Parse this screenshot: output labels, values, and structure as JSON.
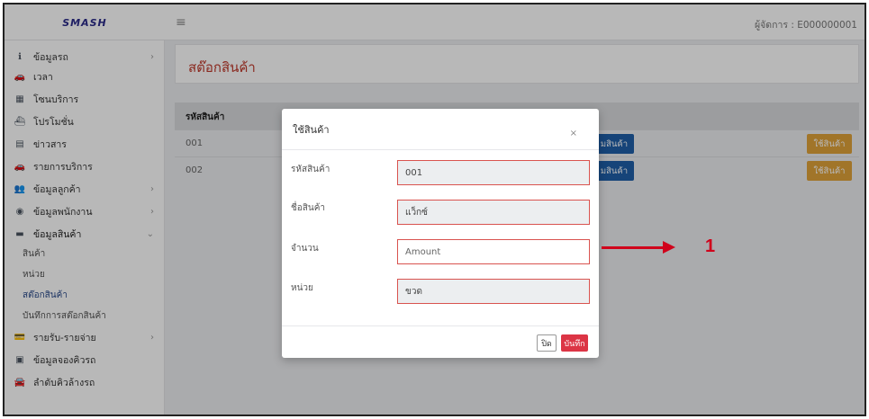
{
  "header": {
    "logo_text": "SMASH",
    "user_label": "ผู้จัดการ : E000000001"
  },
  "sidebar": {
    "items": [
      {
        "label": "ข้อมูลรถ",
        "icon": "info-icon",
        "has_children": true
      },
      {
        "label": "เวลา",
        "icon": "car-icon",
        "has_children": false
      },
      {
        "label": "โซนบริการ",
        "icon": "grid-icon",
        "has_children": false
      },
      {
        "label": "โปรโมชั่น",
        "icon": "ship-icon",
        "has_children": false
      },
      {
        "label": "ข่าวสาร",
        "icon": "news-icon",
        "has_children": false
      },
      {
        "label": "รายการบริการ",
        "icon": "car-icon",
        "has_children": false
      },
      {
        "label": "ข้อมูลลูกค้า",
        "icon": "users-icon",
        "has_children": true
      },
      {
        "label": "ข้อมูลพนักงาน",
        "icon": "user-circle-icon",
        "has_children": true
      },
      {
        "label": "ข้อมูลสินค้า",
        "icon": "box-icon",
        "has_children": true,
        "expanded": true
      },
      {
        "label": "รายรับ-รายจ่าย",
        "icon": "money-icon",
        "has_children": true
      },
      {
        "label": "ข้อมูลจองคิวรถ",
        "icon": "calendar-icon",
        "has_children": false
      },
      {
        "label": "ลำดับคิวล้างรถ",
        "icon": "car-wash-icon",
        "has_children": false
      }
    ],
    "sub_items": [
      {
        "label": "สินค้า",
        "active": false
      },
      {
        "label": "หน่วย",
        "active": false
      },
      {
        "label": "สต๊อกสินค้า",
        "active": true
      },
      {
        "label": "บันทึกการสต๊อกสินค้า",
        "active": false
      }
    ]
  },
  "main": {
    "page_title": "สต๊อกสินค้า",
    "table": {
      "header_code": "รหัสสินค้า",
      "rows": [
        {
          "code": "001",
          "blue_button": "มสินค้า",
          "use_button": "ใช้สินค้า"
        },
        {
          "code": "002",
          "blue_button": "มสินค้า",
          "use_button": "ใช้สินค้า"
        }
      ]
    }
  },
  "modal": {
    "title": "ใช้สินค้า",
    "close_symbol": "×",
    "fields": [
      {
        "label": "รหัสสินค้า",
        "value": "001",
        "placeholder": "",
        "editable": false
      },
      {
        "label": "ชื่อสินค้า",
        "value": "แว็กซ์",
        "placeholder": "",
        "editable": false
      },
      {
        "label": "จำนวน",
        "value": "",
        "placeholder": "Amount",
        "editable": true
      },
      {
        "label": "หน่วย",
        "value": "ขวด",
        "placeholder": "",
        "editable": false
      }
    ],
    "close_button": "ปิด",
    "save_button": "บันทึก"
  },
  "annotation": {
    "number": "1",
    "color": "#d0021b"
  }
}
